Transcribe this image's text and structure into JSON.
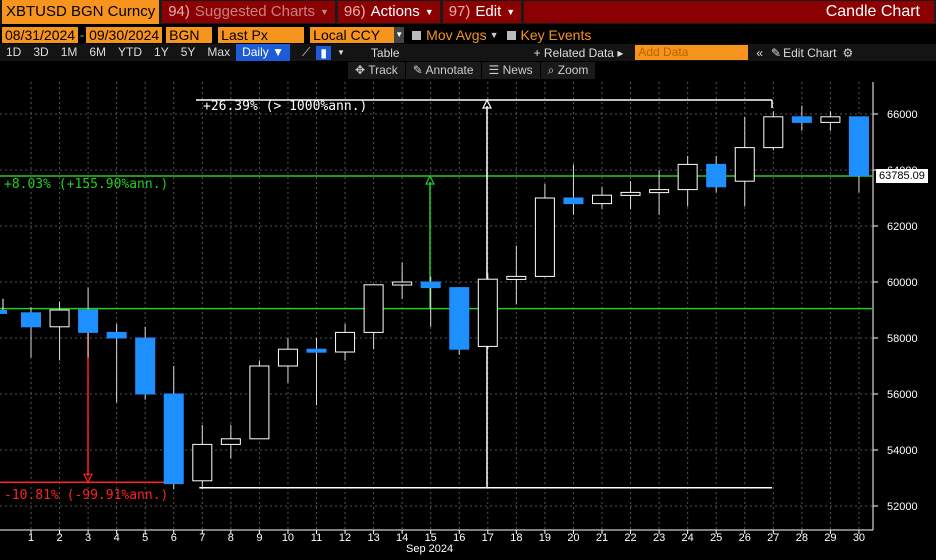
{
  "toolbar": {
    "ticker": "XBTUSD BGN Curncy",
    "suggested": {
      "num": "94)",
      "label": "Suggested Charts"
    },
    "actions": {
      "num": "96)",
      "label": "Actions"
    },
    "edit": {
      "num": "97)",
      "label": "Edit"
    },
    "title": "Candle Chart"
  },
  "settings": {
    "start_date": "08/31/2024",
    "end_date": "09/30/2024",
    "source": "BGN",
    "field": "Last Px",
    "currency": "Local CCY",
    "mov_avgs": "Mov Avgs",
    "key_events": "Key Events"
  },
  "periods": [
    "1D",
    "3D",
    "1M",
    "6M",
    "YTD",
    "1Y",
    "5Y",
    "Max"
  ],
  "frequency": "Daily",
  "table_label": "Table",
  "related_data": "+ Related Data",
  "add_data_placeholder": "Add Data",
  "edit_chart": "Edit Chart",
  "tools": {
    "track": "Track",
    "annotate": "Annotate",
    "news": "News",
    "zoom": "Zoom"
  },
  "annotations": {
    "up_big": "+26.39% (> 1000%ann.)",
    "up_mid": "+8.03% (+155.90%ann.)",
    "down": "-10.81% (-99.91%ann.)",
    "last_price": "63785.09"
  },
  "colors": {
    "accent": "#f7941d",
    "menu": "#8b0000",
    "up_fill": "#000000",
    "down_fill": "#1e8fff",
    "green": "#22cc22",
    "red": "#ff2222"
  },
  "chart_data": {
    "type": "candlestick",
    "x_axis_label": "Sep 2024",
    "x": [
      1,
      2,
      3,
      4,
      5,
      6,
      7,
      8,
      9,
      10,
      11,
      12,
      13,
      14,
      15,
      16,
      17,
      18,
      19,
      20,
      21,
      22,
      23,
      24,
      25,
      26,
      27,
      28,
      29,
      30
    ],
    "ohlc": [
      [
        58900,
        59100,
        57300,
        58400
      ],
      [
        58400,
        59300,
        57200,
        59000
      ],
      [
        59000,
        59800,
        57300,
        58200
      ],
      [
        58200,
        58500,
        55700,
        58000
      ],
      [
        58000,
        58400,
        55800,
        56000
      ],
      [
        56000,
        57000,
        52600,
        52800
      ],
      [
        52900,
        54900,
        52600,
        54200
      ],
      [
        54200,
        54900,
        53700,
        54400
      ],
      [
        54400,
        57200,
        54400,
        57000
      ],
      [
        57000,
        58000,
        56400,
        57600
      ],
      [
        57600,
        58000,
        55600,
        57500
      ],
      [
        57500,
        58500,
        57200,
        58200
      ],
      [
        58200,
        59700,
        57600,
        59900
      ],
      [
        59900,
        60700,
        59400,
        60000
      ],
      [
        60000,
        60200,
        58400,
        59800
      ],
      [
        59800,
        59800,
        57400,
        57600
      ],
      [
        57700,
        60300,
        57600,
        60100
      ],
      [
        60100,
        61300,
        59200,
        60200
      ],
      [
        60200,
        63500,
        60200,
        63000
      ],
      [
        63000,
        64200,
        62400,
        62800
      ],
      [
        62800,
        63400,
        62600,
        63100
      ],
      [
        63100,
        63600,
        62600,
        63200
      ],
      [
        63200,
        64000,
        62400,
        63300
      ],
      [
        63300,
        64500,
        62700,
        64200
      ],
      [
        64200,
        64500,
        63200,
        63400
      ],
      [
        63600,
        65900,
        62700,
        64800
      ],
      [
        64800,
        66100,
        64700,
        65900
      ],
      [
        65900,
        66300,
        65400,
        65700
      ],
      [
        65700,
        66100,
        65400,
        65900
      ],
      [
        65900,
        65900,
        63200,
        63800
      ]
    ],
    "y_ticks": [
      52000,
      54000,
      56000,
      58000,
      60000,
      62000,
      64000,
      66000
    ],
    "y_range": [
      51500,
      67000
    ],
    "hlines": [
      {
        "value": 63785.09,
        "color": "green"
      },
      {
        "value": 59050,
        "color": "green"
      }
    ],
    "last_price": 63785.09
  }
}
